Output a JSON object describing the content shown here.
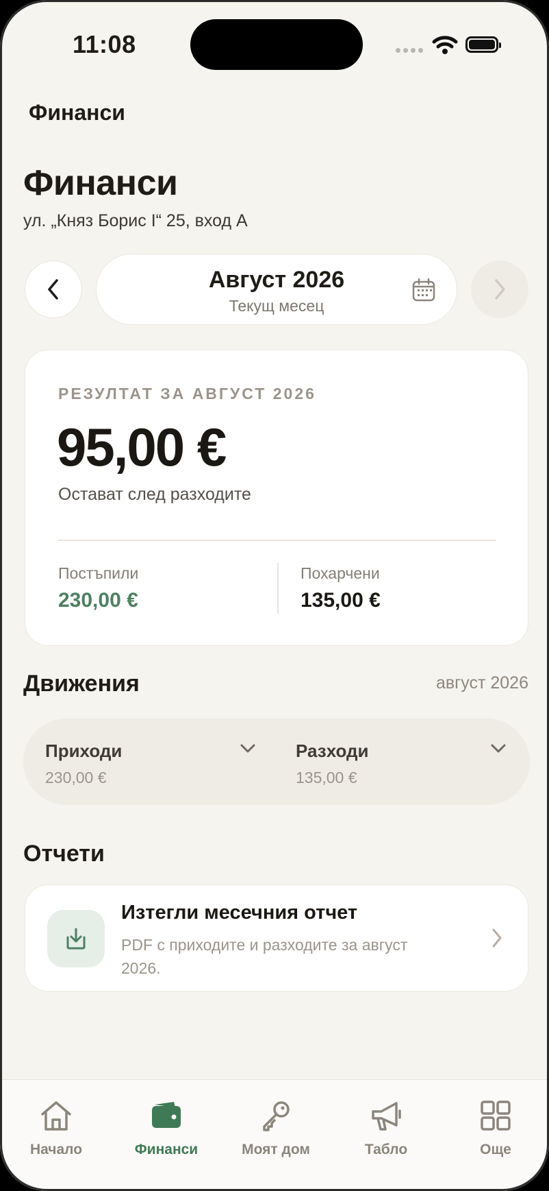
{
  "status_bar": {
    "time": "11:08"
  },
  "header": {
    "nav_title": "Финанси",
    "title": "Финанси",
    "address": "ул. „Княз Борис I“ 25, вход А"
  },
  "month_picker": {
    "month": "Август 2026",
    "subtitle": "Текущ месец",
    "prev_icon": "chevron-left-icon",
    "next_icon": "chevron-right-icon",
    "calendar_icon": "calendar-icon"
  },
  "summary": {
    "label": "РЕЗУЛТАТ ЗА АВГУСТ 2026",
    "amount": "95,00 €",
    "subtitle": "Остават след разходите",
    "income_label": "Постъпили",
    "income_value": "230,00 €",
    "expense_label": "Похарчени",
    "expense_value": "135,00 €",
    "income_color": "#4e8062"
  },
  "movements": {
    "title": "Движения",
    "month": "август 2026",
    "items": [
      {
        "label": "Приходи",
        "value": "230,00 €"
      },
      {
        "label": "Разходи",
        "value": "135,00 €"
      }
    ]
  },
  "reports": {
    "title": "Отчети",
    "card": {
      "title": "Изтегли месечния отчет",
      "description": "PDF с приходите и разходите за август 2026.",
      "icon": "download-icon"
    }
  },
  "tabbar": {
    "accent": "#3f7a56",
    "items": [
      {
        "label": "Начало",
        "icon": "home-icon"
      },
      {
        "label": "Финанси",
        "icon": "wallet-icon",
        "active": true
      },
      {
        "label": "Моят дом",
        "icon": "key-icon"
      },
      {
        "label": "Табло",
        "icon": "megaphone-icon"
      },
      {
        "label": "Още",
        "icon": "grid-icon"
      }
    ]
  }
}
